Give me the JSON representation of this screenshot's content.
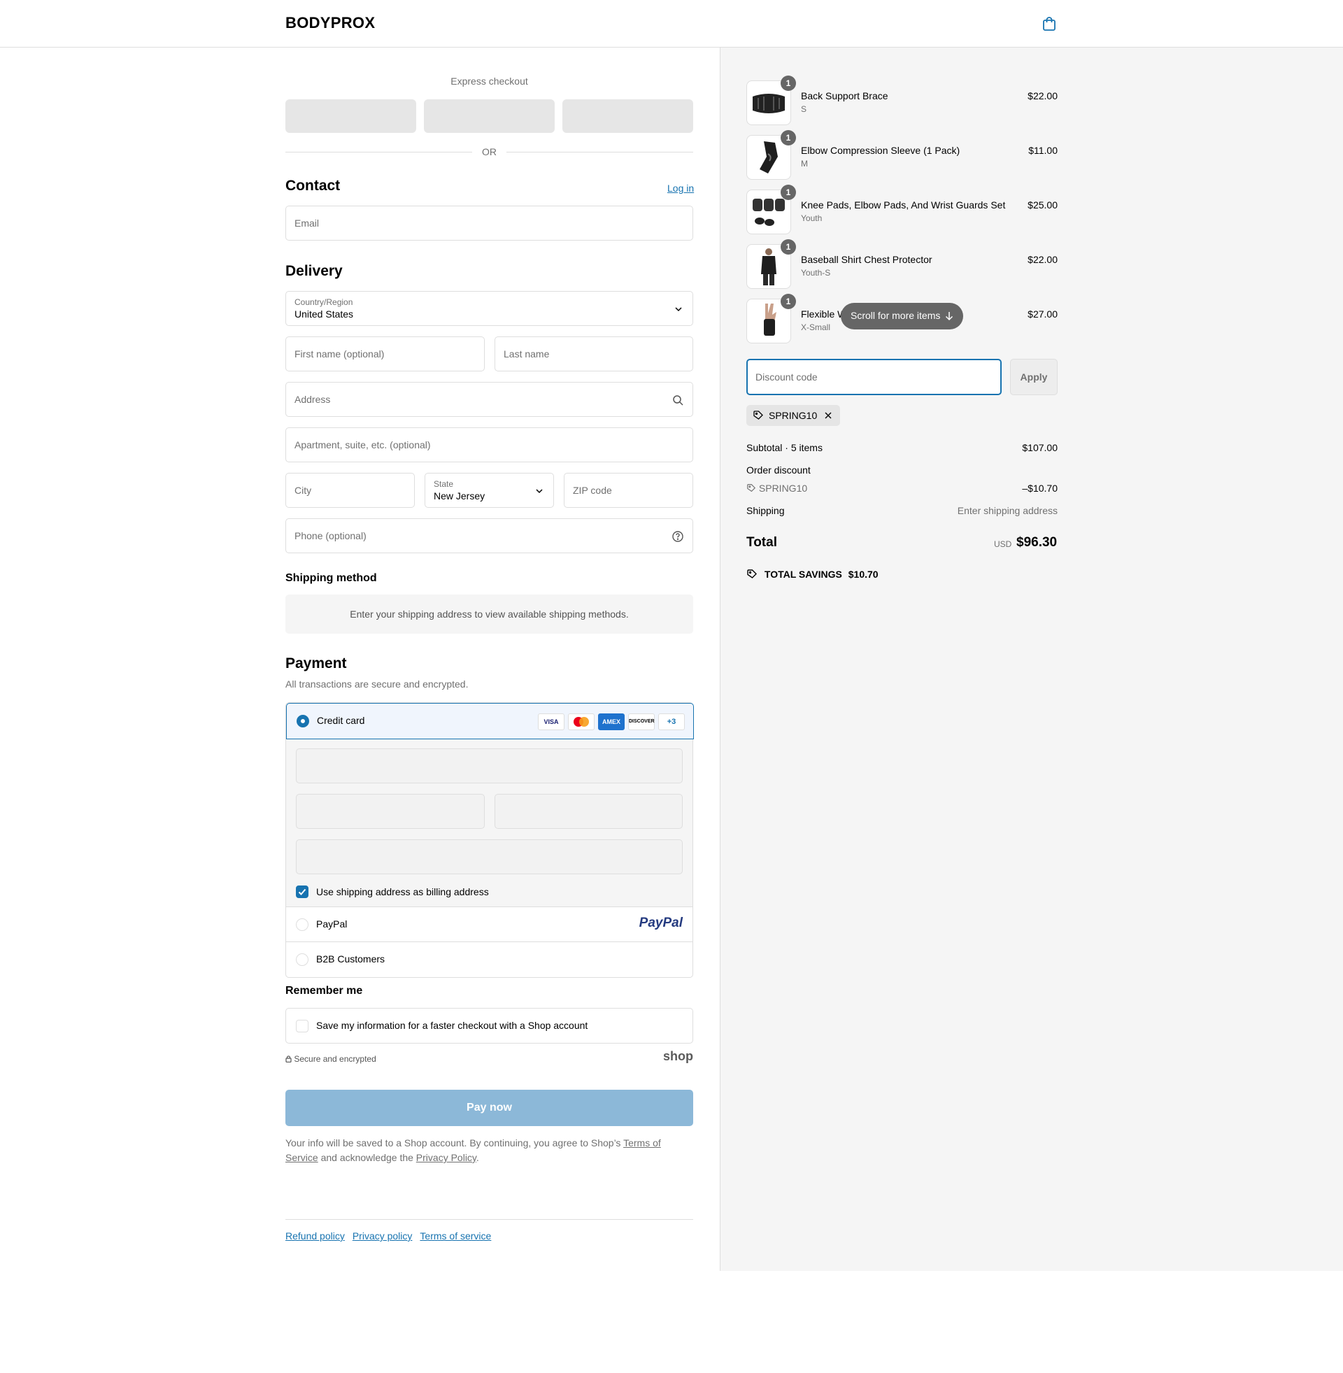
{
  "header": {
    "brand": "BODYPROX",
    "cart_icon": "shopping-bag-icon"
  },
  "express": {
    "title": "Express checkout",
    "or_label": "OR"
  },
  "contact": {
    "title": "Contact",
    "login_label": "Log in",
    "email_placeholder": "Email"
  },
  "delivery": {
    "title": "Delivery",
    "country_label": "Country/Region",
    "country_value": "United States",
    "first_name_placeholder": "First name (optional)",
    "last_name_placeholder": "Last name",
    "address_placeholder": "Address",
    "apartment_placeholder": "Apartment, suite, etc. (optional)",
    "city_placeholder": "City",
    "state_label": "State",
    "state_value": "New Jersey",
    "zip_placeholder": "ZIP code",
    "phone_placeholder": "Phone (optional)"
  },
  "shipping_method": {
    "title": "Shipping method",
    "message": "Enter your shipping address to view available shipping methods."
  },
  "payment": {
    "title": "Payment",
    "subtitle": "All transactions are secure and encrypted.",
    "credit_card_label": "Credit card",
    "card_brands": [
      "VISA",
      "Mastercard",
      "AMEX",
      "DISCOVER"
    ],
    "more_cards": "+3",
    "billing_checkbox_label": "Use shipping address as billing address",
    "paypal_label": "PayPal",
    "paypal_logo": "PayPal",
    "b2b_label": "B2B Customers"
  },
  "remember": {
    "title": "Remember me",
    "checkbox_label": "Save my information for a faster checkout with a Shop account",
    "secure_label": "Secure and encrypted",
    "shop_logo": "shop"
  },
  "pay_button": "Pay now",
  "terms": {
    "prefix": "Your info will be saved to a Shop account. By continuing, you agree to Shop’s ",
    "tos": "Terms of Service",
    "middle": " and acknowledge the ",
    "privacy": "Privacy Policy",
    "suffix": "."
  },
  "footer": {
    "links": [
      "Refund policy",
      "Privacy policy",
      "Terms of service"
    ]
  },
  "order": {
    "items": [
      {
        "qty": "1",
        "name": "Back Support Brace",
        "variant": "S",
        "price": "$22.00"
      },
      {
        "qty": "1",
        "name": "Elbow Compression Sleeve (1 Pack)",
        "variant": "M",
        "price": "$11.00"
      },
      {
        "qty": "1",
        "name": "Knee Pads, Elbow Pads, And Wrist Guards Set",
        "variant": "Youth",
        "price": "$25.00"
      },
      {
        "qty": "1",
        "name": "Baseball Shirt Chest Protector",
        "variant": "Youth-S",
        "price": "$22.00"
      },
      {
        "qty": "1",
        "name": "Flexible W",
        "variant": "X-Small",
        "price": "$27.00"
      }
    ],
    "scroll_hint": "Scroll for more items",
    "discount_placeholder": "Discount code",
    "apply_label": "Apply",
    "applied_code": "SPRING10",
    "subtotal_label": "Subtotal · 5 items",
    "subtotal_value": "$107.00",
    "order_discount_label": "Order discount",
    "discount_code": "SPRING10",
    "discount_value": "–$10.70",
    "shipping_label": "Shipping",
    "shipping_value": "Enter shipping address",
    "total_label": "Total",
    "currency": "USD",
    "total_value": "$96.30",
    "savings_label": "TOTAL SAVINGS",
    "savings_value": "$10.70"
  }
}
